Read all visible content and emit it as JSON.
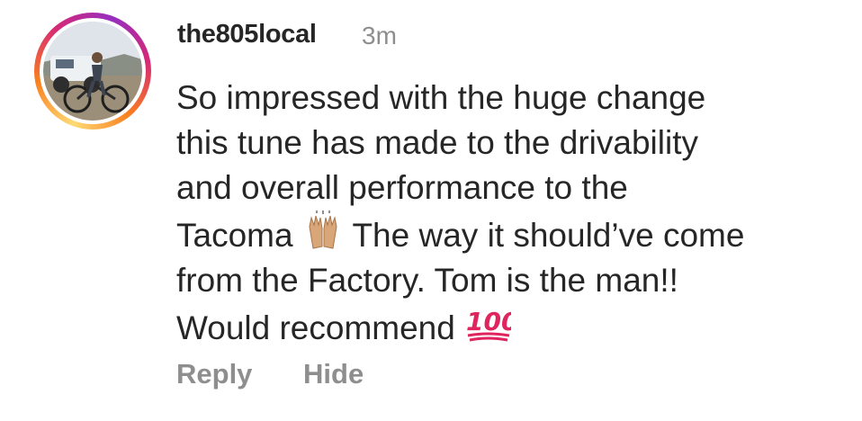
{
  "comment": {
    "username": "the805local",
    "timestamp": "3m",
    "lines": [
      "So impressed with the huge change",
      "this tune has made to the drivability",
      "and overall performance to the",
      "Tacoma",
      " The way it should’ve come",
      "from the Factory. Tom is the man!!",
      "Would recommend "
    ],
    "emoji": {
      "hands": "raising-hands-emoji",
      "hundred": "hundred-points-emoji"
    }
  },
  "actions": {
    "reply_label": "Reply",
    "hide_label": "Hide"
  },
  "colors": {
    "text_primary": "#262626",
    "text_secondary": "#8e8e8e",
    "story_ring_start": "#feda75",
    "story_ring_mid": "#d62976",
    "story_ring_end": "#962fbf",
    "hundred_red": "#e0245e"
  }
}
